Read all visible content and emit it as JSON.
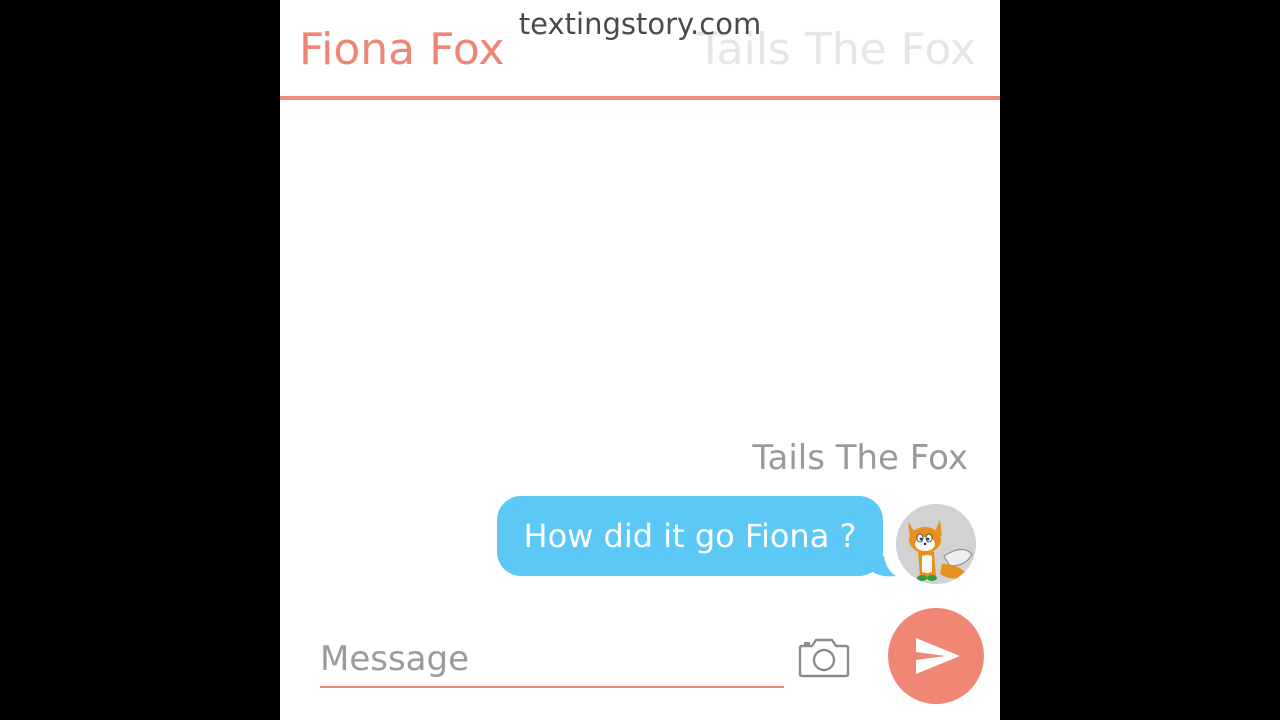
{
  "header": {
    "contact_name": "Fiona Fox",
    "other_name": "Tails The Fox",
    "watermark": "textingstory.com"
  },
  "conversation": {
    "messages": [
      {
        "sender": "Tails The Fox",
        "text": "How did it go Fiona ?"
      }
    ]
  },
  "composer": {
    "placeholder": "Message"
  },
  "icons": {
    "camera": "camera-icon",
    "send": "send-icon",
    "avatar": "fox-avatar"
  },
  "colors": {
    "accent": "#f08775",
    "bubble": "#5bc8f6",
    "name_faded": "#e6e6e6",
    "muted_text": "#9a9a9a"
  }
}
